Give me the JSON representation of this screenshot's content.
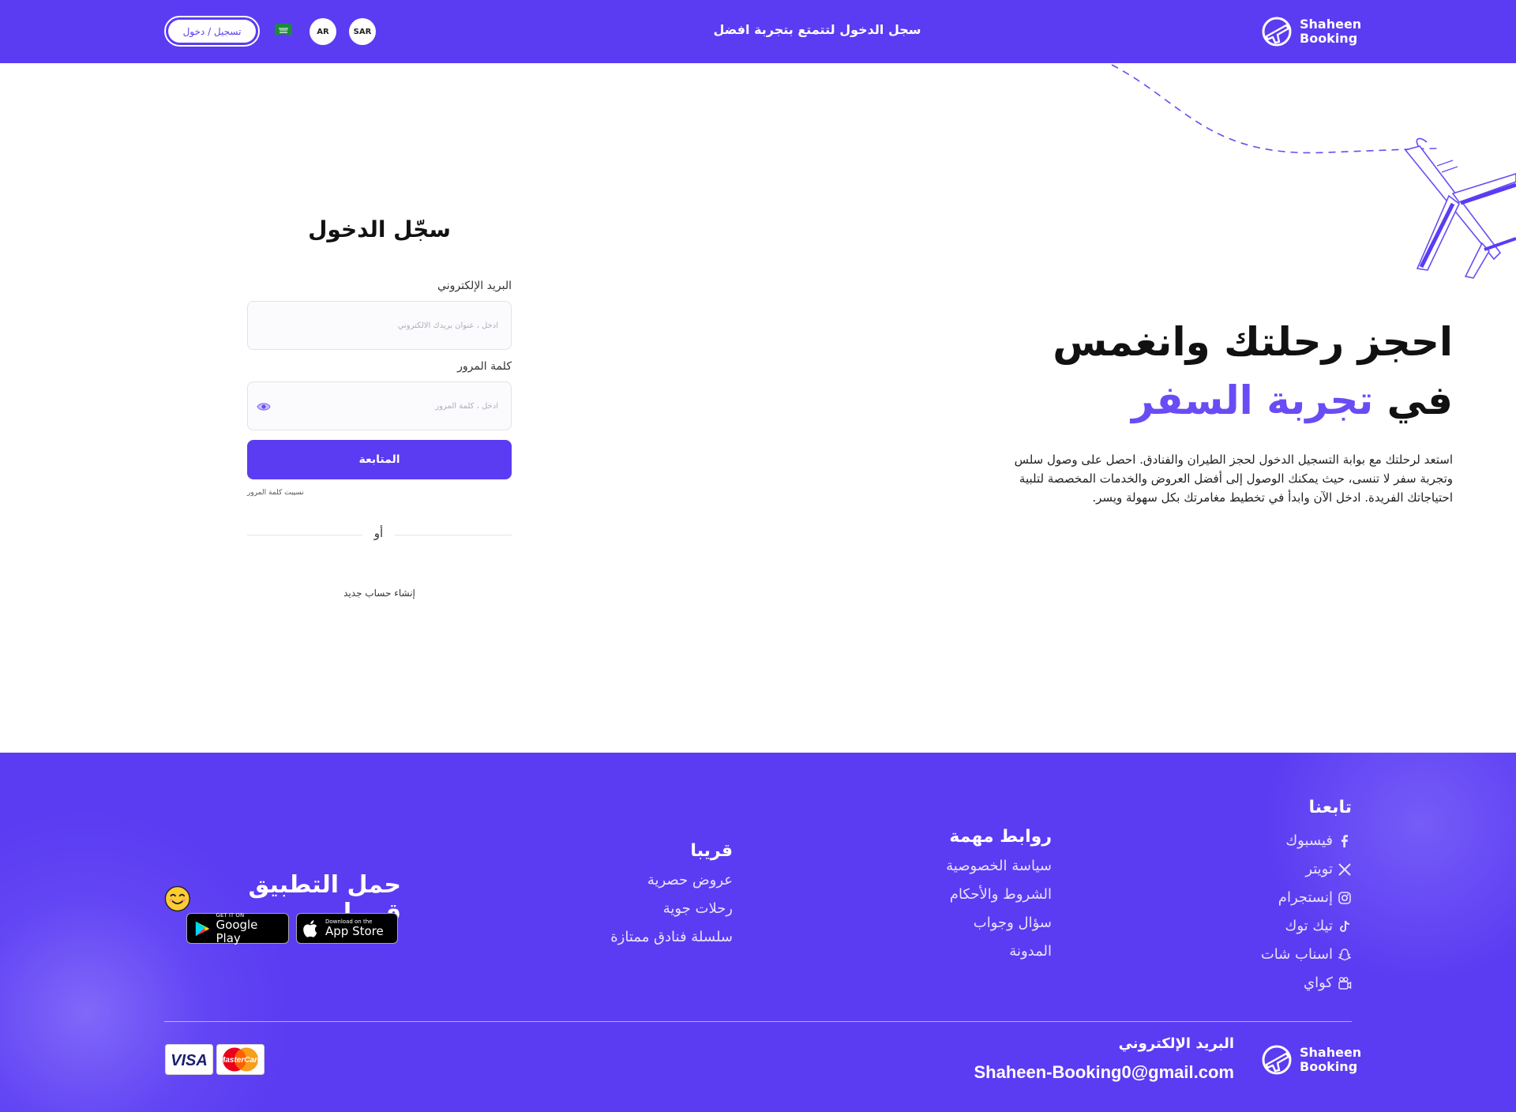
{
  "header": {
    "brand": [
      "Shaheen",
      "Booking"
    ],
    "announcement": "سجل الدخول لتتمتع بتجربة افضل",
    "auth_button": "تسجيل / دخول",
    "language": "AR",
    "currency": "SAR",
    "flag_icon": "saudi-flag-icon"
  },
  "hero": {
    "title_line1": "احجز رحلتك وانغمس",
    "title_line2_prefix": "في",
    "title_line2_accent": "تجربة السفر",
    "description": "استعد لرحلتك مع بوابة التسجيل الدخول لحجز الطيران والفنادق. احصل على وصول سلس وتجربة سفر لا تنسى، حيث يمكنك الوصول إلى أفضل العروض والخدمات المخصصة لتلبية احتياجاتك الفريدة. ادخل الآن وابدأ في تخطيط مغامرتك بكل سهولة ويسر."
  },
  "login": {
    "title": "سجّل الدخول",
    "email_label": "البريد الإلكتروني",
    "email_placeholder": "ادخل ، عنوان بريدك الالكتروني",
    "email_value": "",
    "password_label": "كلمة المرور",
    "password_placeholder": "ادخل ، كلمة المرور",
    "password_value": "",
    "submit": "المتابعة",
    "forgot": "نسيبت كلمة المرور",
    "or": "أو",
    "signup": "إنشاء حساب جديد"
  },
  "footer": {
    "follow": {
      "title": "تابعنا",
      "items": [
        {
          "label": "فيسبوك",
          "icon": "facebook-icon"
        },
        {
          "label": "تويتر",
          "icon": "x-icon"
        },
        {
          "label": "إنستجرام",
          "icon": "instagram-icon"
        },
        {
          "label": "تيك توك",
          "icon": "tiktok-icon"
        },
        {
          "label": "اسناب شات",
          "icon": "snapchat-icon"
        },
        {
          "label": "كواي",
          "icon": "kwai-icon"
        }
      ]
    },
    "links": {
      "title": "روابط مهمة",
      "items": [
        "سياسة الخصوصية",
        "الشروط والأحكام",
        "سؤال وجواب",
        "المدونة"
      ]
    },
    "soon": {
      "title": "قريبا",
      "items": [
        "عروض حصرية",
        "رحلات جوية",
        "سلسلة فنادق ممتازة"
      ]
    },
    "app": {
      "title": "حمل التطبيق قريبا",
      "google_small": "GET IT ON",
      "google_big": "Google Play",
      "apple_small": "Download on the",
      "apple_big": "App Store"
    },
    "email_title": "البريد الإلكتروني",
    "email": "Shaheen-Booking0@gmail.com",
    "payments": [
      "VISA",
      "MasterCard"
    ]
  },
  "colors": {
    "primary": "#5b3cf2",
    "accent": "#6a4cf5"
  }
}
